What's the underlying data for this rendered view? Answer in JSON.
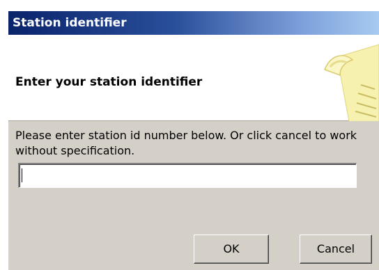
{
  "window": {
    "title": "Station identifier"
  },
  "header": {
    "heading": "Enter your station identifier",
    "icon": "scroll-icon"
  },
  "body": {
    "instructions": "Please enter station id number below. Or click cancel to work without specification."
  },
  "input": {
    "value": "",
    "placeholder": ""
  },
  "buttons": {
    "ok_label": "OK",
    "cancel_label": "Cancel"
  }
}
